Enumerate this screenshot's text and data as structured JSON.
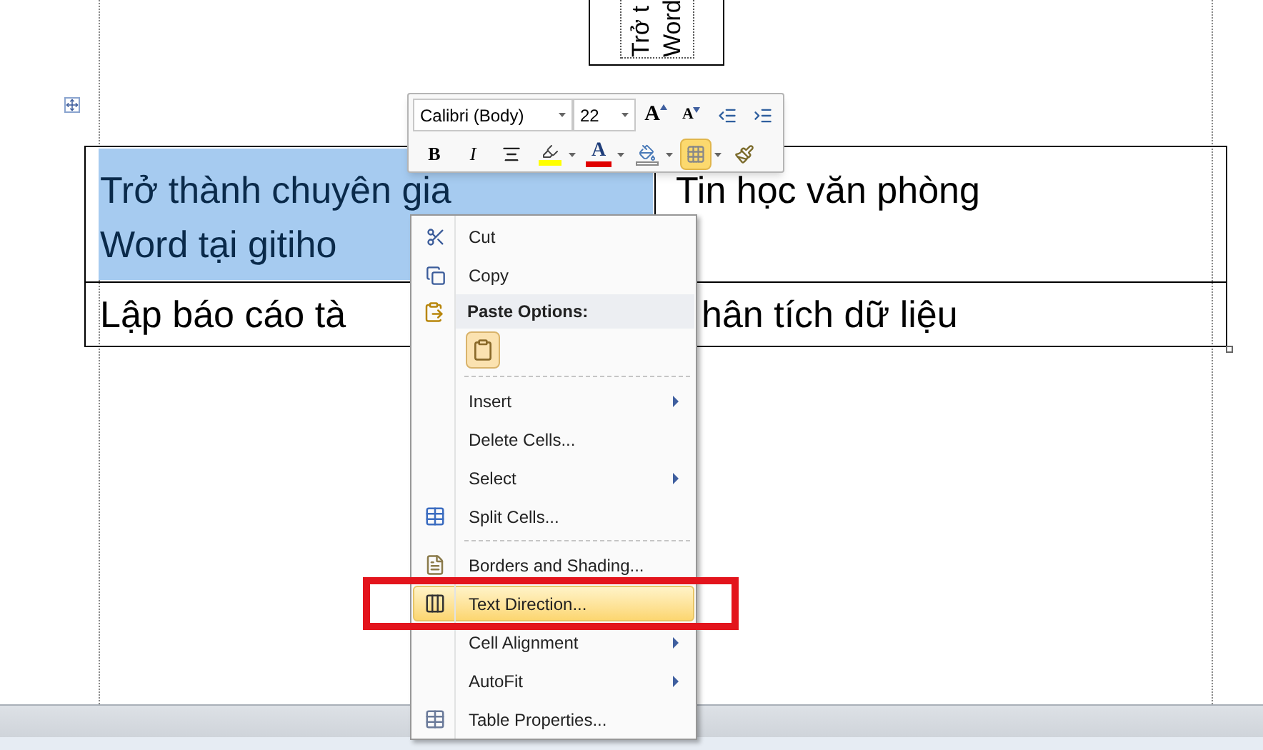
{
  "document": {
    "text_box": {
      "lines": [
        "Trở t",
        "Word"
      ]
    },
    "table": {
      "rows": [
        {
          "cells": [
            {
              "lines": [
                "Trở thành chuyên gia",
                "Word tại gitiho"
              ],
              "selected": true
            },
            {
              "lines": [
                "Tin học văn phòng"
              ],
              "selected": false
            }
          ]
        },
        {
          "cells": [
            {
              "lines": [
                "Lập báo cáo tà"
              ],
              "selected": false
            },
            {
              "lines": [
                "hân tích dữ liệu"
              ],
              "selected": false
            }
          ]
        }
      ]
    }
  },
  "mini_toolbar": {
    "font": {
      "value": "Calibri (Body)"
    },
    "size": {
      "value": "22"
    },
    "row_1": [
      {
        "kind": "grow_font",
        "label": "A",
        "selected": false
      },
      {
        "kind": "shrink_font",
        "label": "A",
        "selected": false
      },
      {
        "kind": "decrease_indent",
        "selected": false
      },
      {
        "kind": "increase_indent",
        "selected": false
      }
    ],
    "row_2": [
      {
        "kind": "bold",
        "label": "B",
        "selected": false,
        "dropdown": false
      },
      {
        "kind": "italic",
        "label": "I",
        "selected": false,
        "dropdown": false
      },
      {
        "kind": "center",
        "selected": false,
        "dropdown": false
      },
      {
        "kind": "highlight",
        "selected": false,
        "dropdown": true
      },
      {
        "kind": "font_color",
        "label": "A",
        "selected": false,
        "dropdown": true
      },
      {
        "kind": "shading",
        "selected": false,
        "dropdown": true
      },
      {
        "kind": "borders",
        "selected": true,
        "dropdown": true
      },
      {
        "kind": "format_painter",
        "selected": false,
        "dropdown": false
      }
    ]
  },
  "context_menu": {
    "items": [
      {
        "kind": "item",
        "label": "Cut",
        "highlighted": false,
        "submenu": false
      },
      {
        "kind": "item",
        "label": "Copy",
        "highlighted": false,
        "submenu": false
      },
      {
        "kind": "header",
        "label": "Paste Options:"
      },
      {
        "kind": "paste_options"
      },
      {
        "kind": "separator"
      },
      {
        "kind": "item",
        "label": "Insert",
        "highlighted": false,
        "submenu": true
      },
      {
        "kind": "item",
        "label": "Delete Cells...",
        "highlighted": false,
        "submenu": false
      },
      {
        "kind": "item",
        "label": "Select",
        "highlighted": false,
        "submenu": true
      },
      {
        "kind": "item",
        "label": "Split Cells...",
        "highlighted": false,
        "submenu": false
      },
      {
        "kind": "separator"
      },
      {
        "kind": "item",
        "label": "Borders and Shading...",
        "highlighted": false,
        "submenu": false
      },
      {
        "kind": "item",
        "label": "Text Direction...",
        "highlighted": true,
        "submenu": false
      },
      {
        "kind": "item",
        "label": "Cell Alignment",
        "highlighted": false,
        "submenu": true
      },
      {
        "kind": "item",
        "label": "AutoFit",
        "highlighted": false,
        "submenu": true
      },
      {
        "kind": "item",
        "label": "Table Properties...",
        "highlighted": false,
        "submenu": false
      }
    ]
  }
}
